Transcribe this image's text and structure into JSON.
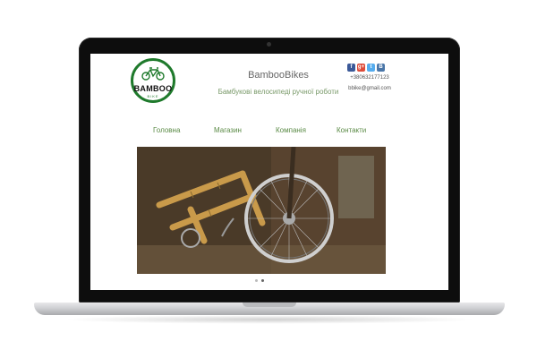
{
  "site": {
    "logo_text": "BAMBOO",
    "logo_sub": "BIKE",
    "title": "BambooBikes",
    "tagline": "Бамбукові велосипеді ручної роботи"
  },
  "contacts": {
    "phone": "+380632177123",
    "email": "bbike@gmail.com"
  },
  "social": [
    {
      "icon": "facebook-icon",
      "glyph": "f",
      "color": "#3b5998"
    },
    {
      "icon": "google-plus-icon",
      "glyph": "g+",
      "color": "#dd4b39"
    },
    {
      "icon": "twitter-icon",
      "glyph": "t",
      "color": "#55acee"
    },
    {
      "icon": "vk-icon",
      "glyph": "B",
      "color": "#4a76a8"
    }
  ],
  "nav": [
    "Головна",
    "Магазин",
    "Компанія",
    "Контакти"
  ],
  "slider": {
    "count": 2,
    "active": 1
  },
  "colors": {
    "brand_green": "#1f7a2c",
    "nav_text": "#5a8a45"
  }
}
